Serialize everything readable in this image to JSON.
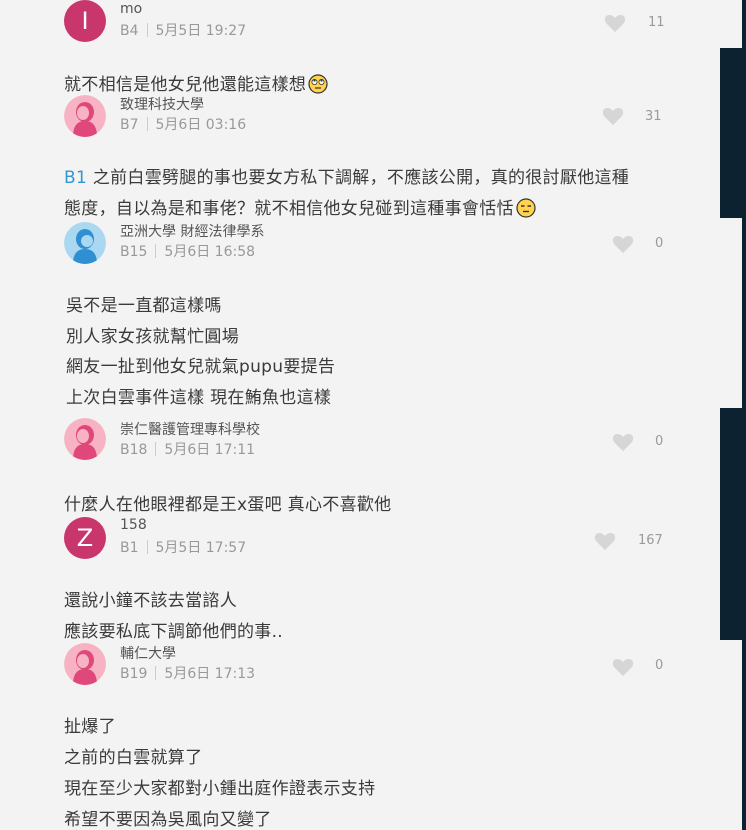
{
  "colors": {
    "panel": "#f3f3f3",
    "frame": "#0c2231",
    "floor_tag": "#3397cf",
    "heart": "#d6d6d6"
  },
  "comments": [
    {
      "avatar_letter": "I",
      "avatar_color": "#c8366b",
      "name": "mo",
      "floor": "B4",
      "time": "5月5日 19:27",
      "likes": "11"
    },
    {
      "body": [
        "就不相信是他女兒他還能這樣想"
      ],
      "body_emoji": "rolling-eyes-emoji",
      "avatar": "female",
      "name": "致理科技大學",
      "floor": "B7",
      "time": "5月6日 03:16",
      "likes": "31"
    },
    {
      "reply_to": "B1",
      "body": [
        "之前白雲劈腿的事也要女方私下調解，不應該公開，真的很討厭他這種",
        "態度，自以為是和事佬？就不相信他女兒碰到這種事會恬恬"
      ],
      "body_emoji": "expressionless-emoji",
      "avatar": "male",
      "name": "亞洲大學 財經法律學系",
      "floor": "B15",
      "time": "5月6日 16:58",
      "likes": "0"
    },
    {
      "body": [
        "吳不是一直都這樣嗎",
        "別人家女孩就幫忙圓場",
        "網友一扯到他女兒就氣pupu要提告",
        "上次白雲事件這樣 現在鮪魚也這樣"
      ],
      "avatar": "female",
      "name": "崇仁醫護管理專科學校",
      "floor": "B18",
      "time": "5月6日 17:11",
      "likes": "0"
    },
    {
      "body": [
        "什麼人在他眼裡都是王x蛋吧 真心不喜歡他"
      ],
      "avatar_letter": "Z",
      "avatar_color": "#c8366b",
      "name": "158",
      "floor": "B1",
      "time": "5月5日 17:57",
      "likes": "167"
    },
    {
      "body": [
        "還說小鐘不該去當諮人",
        "應該要私底下調節他們的事.."
      ],
      "avatar": "female",
      "name": "輔仁大學",
      "floor": "B19",
      "time": "5月6日 17:13",
      "likes": "0"
    },
    {
      "body": [
        "扯爆了",
        "之前的白雲就算了",
        "現在至少大家都對小鍾出庭作證表示支持",
        "希望不要因為吳風向又變了"
      ]
    }
  ]
}
